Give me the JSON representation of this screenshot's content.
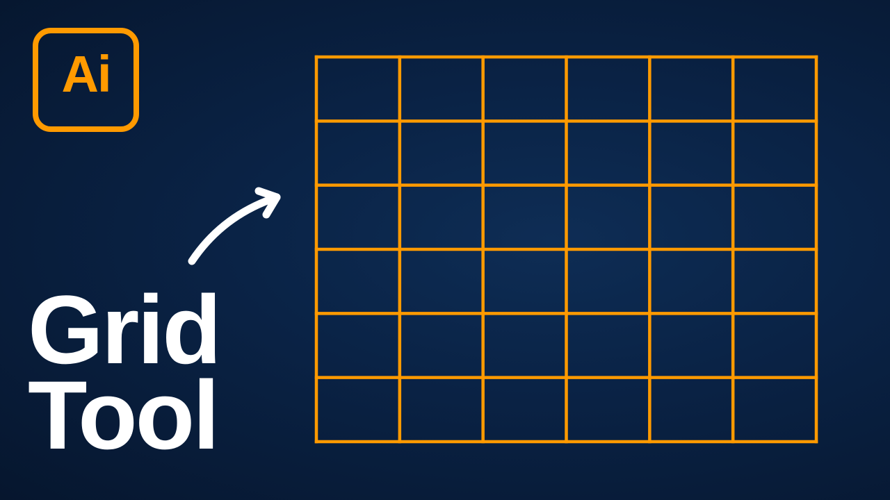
{
  "logo": {
    "text": "Ai",
    "color": "#ff9a00",
    "icon": "adobe-illustrator-logo"
  },
  "headline": {
    "line1": "Grid",
    "line2": "Tool",
    "color": "#ffffff"
  },
  "grid": {
    "rows": 6,
    "columns": 6,
    "color": "#ff9a00"
  },
  "arrow": {
    "icon": "curved-arrow-icon",
    "color": "#ffffff"
  }
}
